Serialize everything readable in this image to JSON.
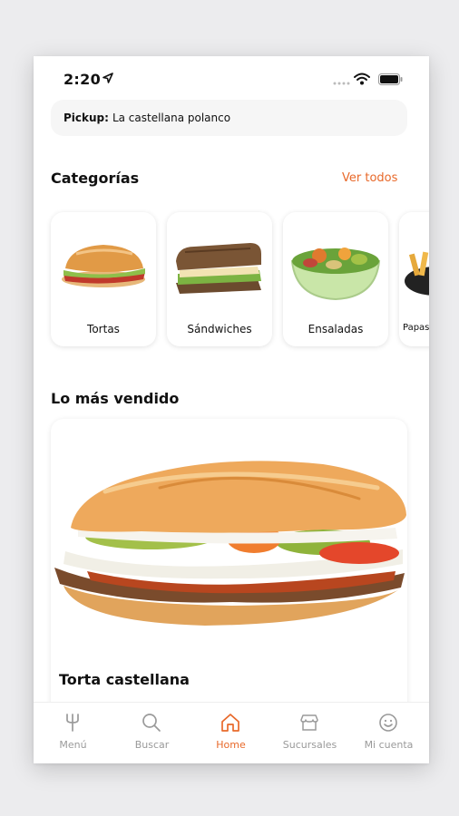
{
  "status_bar": {
    "time": "2:20"
  },
  "pickup": {
    "label": "Pickup:",
    "value": "La castellana polanco"
  },
  "categories": {
    "title": "Categorías",
    "see_all": "Ver todos",
    "items": [
      {
        "label": "Tortas"
      },
      {
        "label": "Sándwiches"
      },
      {
        "label": "Ensaladas"
      },
      {
        "label": "Papas"
      }
    ]
  },
  "best_sellers": {
    "title": "Lo más vendido",
    "product_name": "Torta castellana"
  },
  "tab_bar": {
    "items": [
      {
        "label": "Menú",
        "icon": "fork-icon"
      },
      {
        "label": "Buscar",
        "icon": "search-icon"
      },
      {
        "label": "Home",
        "icon": "home-icon",
        "active": true
      },
      {
        "label": "Sucursales",
        "icon": "store-icon"
      },
      {
        "label": "Mi cuenta",
        "icon": "smiley-icon"
      }
    ]
  },
  "colors": {
    "accent": "#e8692a",
    "inactive": "#9a9a9a"
  }
}
